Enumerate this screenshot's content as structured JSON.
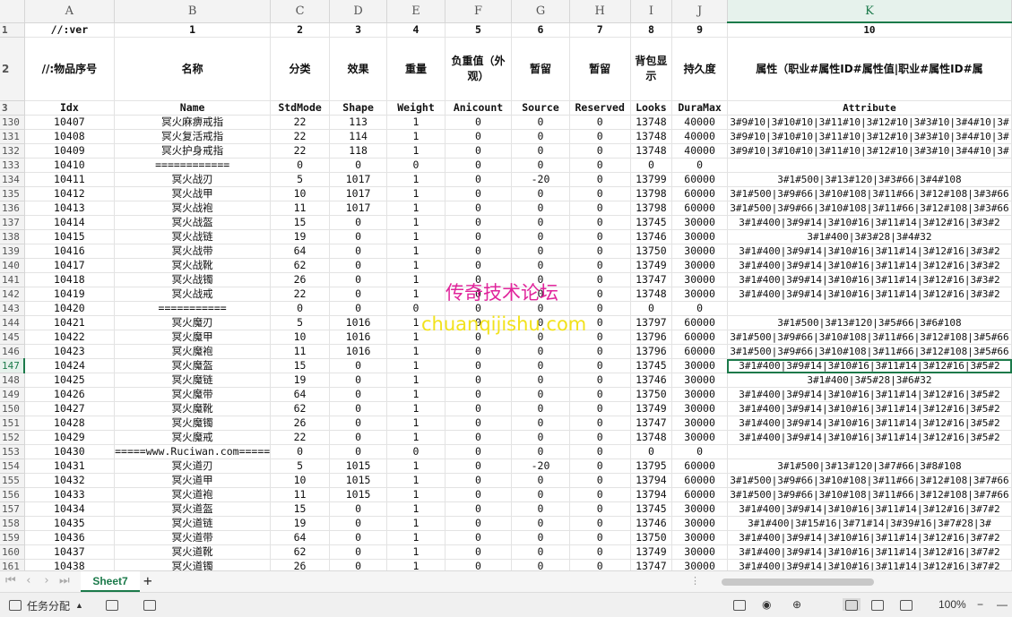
{
  "columns": [
    {
      "letter": "A",
      "width": 112
    },
    {
      "letter": "B",
      "width": 160
    },
    {
      "letter": "C",
      "width": 69
    },
    {
      "letter": "D",
      "width": 70
    },
    {
      "letter": "E",
      "width": 69
    },
    {
      "letter": "F",
      "width": 78
    },
    {
      "letter": "G",
      "width": 69
    },
    {
      "letter": "H",
      "width": 70
    },
    {
      "letter": "I",
      "width": 49
    },
    {
      "letter": "J",
      "width": 64
    },
    {
      "letter": "K",
      "width": 318
    }
  ],
  "header_rows": [
    {
      "num": "1",
      "cells": [
        "//:ver",
        "1",
        "2",
        "3",
        "4",
        "5",
        "6",
        "7",
        "8",
        "9",
        "10"
      ]
    },
    {
      "num": "2",
      "cells": [
        "//:物品序号",
        "名称",
        "分类",
        "效果",
        "重量",
        "负重值（外观）",
        "暂留",
        "暂留",
        "背包显示",
        "持久度",
        "属性（职业#属性ID#属性值|职业#属性ID#属"
      ]
    },
    {
      "num": "3",
      "cells": [
        "Idx",
        "Name",
        "StdMode",
        "Shape",
        "Weight",
        "Anicount",
        "Source",
        "Reserved",
        "Looks",
        "DuraMax",
        "Attribute"
      ]
    }
  ],
  "rows": [
    {
      "num": "130",
      "cells": [
        "10407",
        "冥火麻痹戒指",
        "22",
        "113",
        "1",
        "0",
        "0",
        "0",
        "13748",
        "40000",
        "3#9#10|3#10#10|3#11#10|3#12#10|3#3#10|3#4#10|3#"
      ]
    },
    {
      "num": "131",
      "cells": [
        "10408",
        "冥火复活戒指",
        "22",
        "114",
        "1",
        "0",
        "0",
        "0",
        "13748",
        "40000",
        "3#9#10|3#10#10|3#11#10|3#12#10|3#3#10|3#4#10|3#"
      ]
    },
    {
      "num": "132",
      "cells": [
        "10409",
        "冥火护身戒指",
        "22",
        "118",
        "1",
        "0",
        "0",
        "0",
        "13748",
        "40000",
        "3#9#10|3#10#10|3#11#10|3#12#10|3#3#10|3#4#10|3#"
      ]
    },
    {
      "num": "133",
      "cells": [
        "10410",
        "============",
        "0",
        "0",
        "0",
        "0",
        "0",
        "0",
        "0",
        "0",
        ""
      ]
    },
    {
      "num": "134",
      "cells": [
        "10411",
        "冥火战刃",
        "5",
        "1017",
        "1",
        "0",
        "-20",
        "0",
        "13799",
        "60000",
        "3#1#500|3#13#120|3#3#66|3#4#108"
      ]
    },
    {
      "num": "135",
      "cells": [
        "10412",
        "冥火战甲",
        "10",
        "1017",
        "1",
        "0",
        "0",
        "0",
        "13798",
        "60000",
        "3#1#500|3#9#66|3#10#108|3#11#66|3#12#108|3#3#66"
      ]
    },
    {
      "num": "136",
      "cells": [
        "10413",
        "冥火战袍",
        "11",
        "1017",
        "1",
        "0",
        "0",
        "0",
        "13798",
        "60000",
        "3#1#500|3#9#66|3#10#108|3#11#66|3#12#108|3#3#66"
      ]
    },
    {
      "num": "137",
      "cells": [
        "10414",
        "冥火战盔",
        "15",
        "0",
        "1",
        "0",
        "0",
        "0",
        "13745",
        "30000",
        "3#1#400|3#9#14|3#10#16|3#11#14|3#12#16|3#3#2"
      ]
    },
    {
      "num": "138",
      "cells": [
        "10415",
        "冥火战链",
        "19",
        "0",
        "1",
        "0",
        "0",
        "0",
        "13746",
        "30000",
        "3#1#400|3#3#28|3#4#32"
      ]
    },
    {
      "num": "139",
      "cells": [
        "10416",
        "冥火战带",
        "64",
        "0",
        "1",
        "0",
        "0",
        "0",
        "13750",
        "30000",
        "3#1#400|3#9#14|3#10#16|3#11#14|3#12#16|3#3#2"
      ]
    },
    {
      "num": "140",
      "cells": [
        "10417",
        "冥火战靴",
        "62",
        "0",
        "1",
        "0",
        "0",
        "0",
        "13749",
        "30000",
        "3#1#400|3#9#14|3#10#16|3#11#14|3#12#16|3#3#2"
      ]
    },
    {
      "num": "141",
      "cells": [
        "10418",
        "冥火战镯",
        "26",
        "0",
        "1",
        "0",
        "0",
        "0",
        "13747",
        "30000",
        "3#1#400|3#9#14|3#10#16|3#11#14|3#12#16|3#3#2"
      ]
    },
    {
      "num": "142",
      "cells": [
        "10419",
        "冥火战戒",
        "22",
        "0",
        "1",
        "0",
        "0",
        "0",
        "13748",
        "30000",
        "3#1#400|3#9#14|3#10#16|3#11#14|3#12#16|3#3#2"
      ]
    },
    {
      "num": "143",
      "cells": [
        "10420",
        "===========",
        "0",
        "0",
        "0",
        "0",
        "0",
        "0",
        "0",
        "0",
        ""
      ]
    },
    {
      "num": "144",
      "cells": [
        "10421",
        "冥火魔刃",
        "5",
        "1016",
        "1",
        "0",
        "0",
        "0",
        "13797",
        "60000",
        "3#1#500|3#13#120|3#5#66|3#6#108"
      ]
    },
    {
      "num": "145",
      "cells": [
        "10422",
        "冥火魔甲",
        "10",
        "1016",
        "1",
        "0",
        "0",
        "0",
        "13796",
        "60000",
        "3#1#500|3#9#66|3#10#108|3#11#66|3#12#108|3#5#66"
      ]
    },
    {
      "num": "146",
      "cells": [
        "10423",
        "冥火魔袍",
        "11",
        "1016",
        "1",
        "0",
        "0",
        "0",
        "13796",
        "60000",
        "3#1#500|3#9#66|3#10#108|3#11#66|3#12#108|3#5#66"
      ]
    },
    {
      "num": "147",
      "cells": [
        "10424",
        "冥火魔盔",
        "15",
        "0",
        "1",
        "0",
        "0",
        "0",
        "13745",
        "30000",
        "3#1#400|3#9#14|3#10#16|3#11#14|3#12#16|3#5#2"
      ]
    },
    {
      "num": "148",
      "cells": [
        "10425",
        "冥火魔链",
        "19",
        "0",
        "1",
        "0",
        "0",
        "0",
        "13746",
        "30000",
        "3#1#400|3#5#28|3#6#32"
      ]
    },
    {
      "num": "149",
      "cells": [
        "10426",
        "冥火魔带",
        "64",
        "0",
        "1",
        "0",
        "0",
        "0",
        "13750",
        "30000",
        "3#1#400|3#9#14|3#10#16|3#11#14|3#12#16|3#5#2"
      ]
    },
    {
      "num": "150",
      "cells": [
        "10427",
        "冥火魔靴",
        "62",
        "0",
        "1",
        "0",
        "0",
        "0",
        "13749",
        "30000",
        "3#1#400|3#9#14|3#10#16|3#11#14|3#12#16|3#5#2"
      ]
    },
    {
      "num": "151",
      "cells": [
        "10428",
        "冥火魔镯",
        "26",
        "0",
        "1",
        "0",
        "0",
        "0",
        "13747",
        "30000",
        "3#1#400|3#9#14|3#10#16|3#11#14|3#12#16|3#5#2"
      ]
    },
    {
      "num": "152",
      "cells": [
        "10429",
        "冥火魔戒",
        "22",
        "0",
        "1",
        "0",
        "0",
        "0",
        "13748",
        "30000",
        "3#1#400|3#9#14|3#10#16|3#11#14|3#12#16|3#5#2"
      ]
    },
    {
      "num": "153",
      "cells": [
        "10430",
        "=====www.Ruciwan.com=====",
        "0",
        "0",
        "0",
        "0",
        "0",
        "0",
        "0",
        "0",
        ""
      ]
    },
    {
      "num": "154",
      "cells": [
        "10431",
        "冥火道刃",
        "5",
        "1015",
        "1",
        "0",
        "-20",
        "0",
        "13795",
        "60000",
        "3#1#500|3#13#120|3#7#66|3#8#108"
      ]
    },
    {
      "num": "155",
      "cells": [
        "10432",
        "冥火道甲",
        "10",
        "1015",
        "1",
        "0",
        "0",
        "0",
        "13794",
        "60000",
        "3#1#500|3#9#66|3#10#108|3#11#66|3#12#108|3#7#66"
      ]
    },
    {
      "num": "156",
      "cells": [
        "10433",
        "冥火道袍",
        "11",
        "1015",
        "1",
        "0",
        "0",
        "0",
        "13794",
        "60000",
        "3#1#500|3#9#66|3#10#108|3#11#66|3#12#108|3#7#66"
      ]
    },
    {
      "num": "157",
      "cells": [
        "10434",
        "冥火道盔",
        "15",
        "0",
        "1",
        "0",
        "0",
        "0",
        "13745",
        "30000",
        "3#1#400|3#9#14|3#10#16|3#11#14|3#12#16|3#7#2"
      ]
    },
    {
      "num": "158",
      "cells": [
        "10435",
        "冥火道链",
        "19",
        "0",
        "1",
        "0",
        "0",
        "0",
        "13746",
        "30000",
        "3#1#400|3#15#16|3#71#14|3#39#16|3#7#28|3#"
      ]
    },
    {
      "num": "159",
      "cells": [
        "10436",
        "冥火道带",
        "64",
        "0",
        "1",
        "0",
        "0",
        "0",
        "13750",
        "30000",
        "3#1#400|3#9#14|3#10#16|3#11#14|3#12#16|3#7#2"
      ]
    },
    {
      "num": "160",
      "cells": [
        "10437",
        "冥火道靴",
        "62",
        "0",
        "1",
        "0",
        "0",
        "0",
        "13749",
        "30000",
        "3#1#400|3#9#14|3#10#16|3#11#14|3#12#16|3#7#2"
      ]
    },
    {
      "num": "161",
      "cells": [
        "10438",
        "冥火道镯",
        "26",
        "0",
        "1",
        "0",
        "0",
        "0",
        "13747",
        "30000",
        "3#1#400|3#9#14|3#10#16|3#11#14|3#12#16|3#7#2"
      ]
    }
  ],
  "selected_row": "147",
  "watermark": {
    "cn": "传奇技术论坛",
    "url": "chuanqijishu.com"
  },
  "sheet_tab": "Sheet7",
  "status": {
    "task_label": "任务分配",
    "zoom": "100%"
  }
}
